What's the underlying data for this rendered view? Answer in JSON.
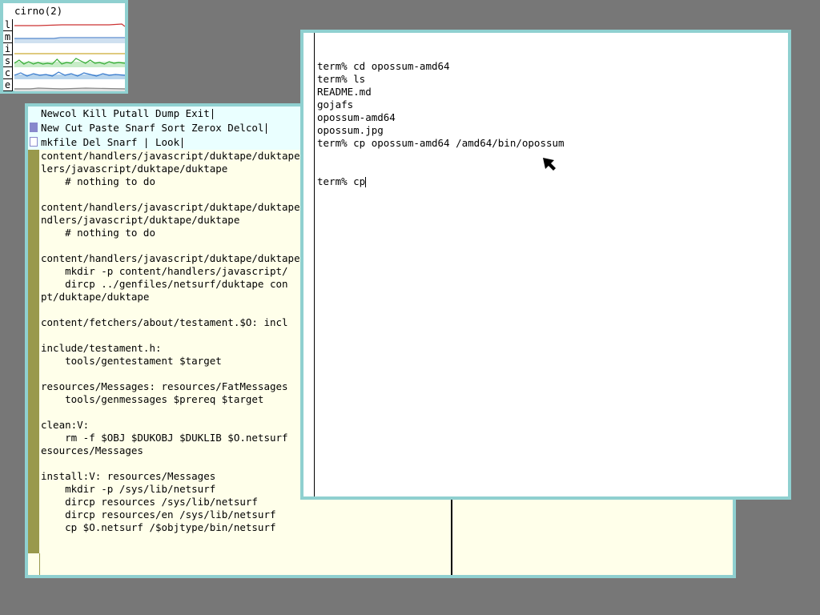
{
  "stats": {
    "title": "cirno(2)",
    "rows": [
      {
        "letter": "l",
        "color": "#cc3333"
      },
      {
        "letter": "m",
        "color": "#5588cc"
      },
      {
        "letter": "i",
        "color": "#ccaa33"
      },
      {
        "letter": "s",
        "color": "#33aa33"
      },
      {
        "letter": "c",
        "color": "#3377cc"
      },
      {
        "letter": "e",
        "color": "#888888"
      }
    ]
  },
  "acme": {
    "column_tag": "Newcol Kill Putall Dump Exit",
    "column_tag2": "New Cut Paste Snarf Sort Zerox Delcol",
    "window_tag": "mkfile Del Snarf | Look",
    "body_lines": [
      "content/handlers/javascript/duktape/duktape",
      "lers/javascript/duktape/duktape",
      "    # nothing to do",
      "",
      "content/handlers/javascript/duktape/duktape",
      "ndlers/javascript/duktape/duktape",
      "    # nothing to do",
      "",
      "content/handlers/javascript/duktape/duktape",
      "    mkdir -p content/handlers/javascript/",
      "    dircp ../genfiles/netsurf/duktape con",
      "pt/duktape/duktape",
      "",
      "content/fetchers/about/testament.$O: incl",
      "",
      "include/testament.h:",
      "    tools/gentestament $target",
      "",
      "resources/Messages: resources/FatMessages",
      "    tools/genmessages $prereq $target",
      "",
      "clean:V:",
      "    rm -f $OBJ $DUKOBJ $DUKLIB $O.netsurf",
      "esources/Messages",
      "",
      "install:V: resources/Messages",
      "    mkdir -p /sys/lib/netsurf",
      "    dircp resources /sys/lib/netsurf",
      "    dircp resources/en /sys/lib/netsurf",
      "    cp $O.netsurf /$objtype/bin/netsurf"
    ]
  },
  "terminal": {
    "lines": [
      "term% cd opossum-amd64",
      "term% ls",
      "README.md",
      "gojafs",
      "opossum-amd64",
      "opossum.jpg",
      "term% cp opossum-amd64 /amd64/bin/opossum"
    ],
    "current_input": "term% cp"
  },
  "colors": {
    "desktop": "#777777",
    "window_border": "#8fd0d0",
    "acme_body": "#ffffea",
    "acme_tag": "#eaffff",
    "scrollbar": "#99994c"
  }
}
